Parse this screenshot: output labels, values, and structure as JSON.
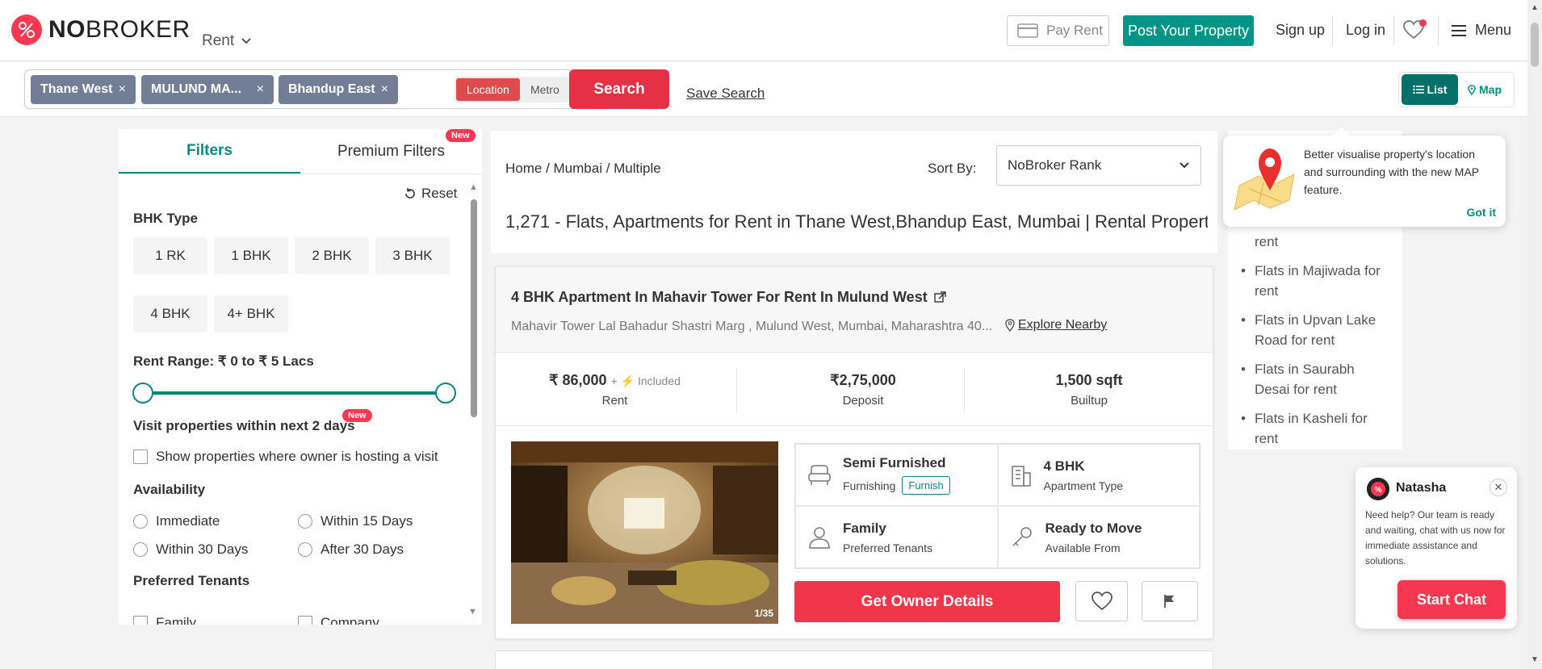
{
  "header": {
    "logo_text": "NOBROKER",
    "rent_dropdown": "Rent",
    "pay_rent": "Pay Rent",
    "post_property": "Post Your Property",
    "sign_up": "Sign up",
    "log_in": "Log in",
    "menu": "Menu"
  },
  "search": {
    "chips": [
      "Thane West",
      "MULUND MA...",
      "Bhandup East"
    ],
    "chip_close": "×",
    "toggle_location": "Location",
    "toggle_metro": "Metro",
    "search_button": "Search",
    "save_search": "Save Search",
    "view_list": "List",
    "view_map": "Map"
  },
  "filters": {
    "tab_filters": "Filters",
    "tab_premium": "Premium Filters",
    "new_badge": "New",
    "reset": "Reset",
    "bhk_heading": "BHK Type",
    "bhk_options": [
      "1 RK",
      "1 BHK",
      "2 BHK",
      "3 BHK",
      "4 BHK",
      "4+ BHK"
    ],
    "rent_range": "Rent Range: ₹ 0 to ₹ 5 Lacs",
    "visit_heading": "Visit properties within next 2 days",
    "visit_new": "New",
    "visit_checkbox": "Show properties where owner is hosting a visit",
    "availability_heading": "Availability",
    "availability_options": [
      "Immediate",
      "Within 15 Days",
      "Within 30 Days",
      "After 30 Days"
    ],
    "tenants_heading": "Preferred Tenants",
    "tenant_options": [
      "Family",
      "Company"
    ]
  },
  "listing_header": {
    "breadcrumb": "Home  / Mumbai / Multiple",
    "sort_by_label": "Sort By:",
    "sort_value": "NoBroker Rank",
    "results_title": "1,271 - Flats, Apartments for Rent in Thane West,Bhandup East, Mumbai | Rental Properties in Thane West"
  },
  "property": {
    "title": "4 BHK Apartment In Mahavir Tower For Rent In Mulund West",
    "address": "Mahavir Tower  Lal Bahadur Shastri Marg , Mulund West, Mumbai, Maharashtra 40...",
    "explore_nearby": "Explore Nearby",
    "rent_value": "₹ 86,000",
    "rent_included": "+ ⚡ Included",
    "rent_label": "Rent",
    "deposit_value": "₹2,75,000",
    "deposit_label": "Deposit",
    "builtup_value": "1,500 sqft",
    "builtup_label": "Builtup",
    "image_count": "1/35",
    "furnishing_value": "Semi Furnished",
    "furnishing_label": "Furnishing",
    "furnish_tag": "Furnish",
    "apartment_value": "4 BHK",
    "apartment_label": "Apartment Type",
    "tenants_value": "Family",
    "tenants_label": "Preferred Tenants",
    "available_value": "Ready to Move",
    "available_label": "Available From",
    "owner_button": "Get Owner Details"
  },
  "sidebar_links": [
    "Flats in Purna for rent",
    "Flats in Majiwada for rent",
    "Flats in Upvan Lake Road for rent",
    "Flats in Saurabh Desai for rent",
    "Flats in Kasheli for rent"
  ],
  "map_tooltip": {
    "text": "Better visualise property's location and surrounding with the new MAP feature.",
    "got_it": "Got it"
  },
  "chat": {
    "name": "Natasha",
    "message": "Need help? Our team is ready and waiting, chat with us now for immediate assistance and solutions.",
    "start_chat": "Start Chat"
  },
  "colors": {
    "brand_red": "#fd3752",
    "teal": "#009587",
    "chip_gray": "#717e95"
  }
}
